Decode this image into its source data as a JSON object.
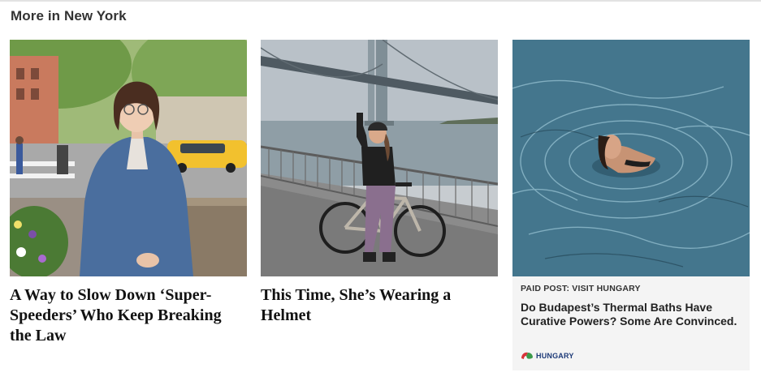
{
  "section": {
    "title": "More in New York"
  },
  "cards": [
    {
      "headline": "A Way to Slow Down ‘Super-Speeders’ Who Keep Breaking the Law",
      "image_alt": "woman in denim jacket on city sidewalk"
    },
    {
      "headline": "This Time, She’s Wearing a Helmet",
      "image_alt": "cyclist with raised arm near bridge"
    },
    {
      "image_alt": "person swimming in thermal water",
      "sponsor_label": "PAID POST: VISIT HUNGARY",
      "headline": "Do Budapest’s Thermal Baths Have Curative Powers? Some Are Convinced.",
      "logo_text": "HUNGARY"
    }
  ]
}
